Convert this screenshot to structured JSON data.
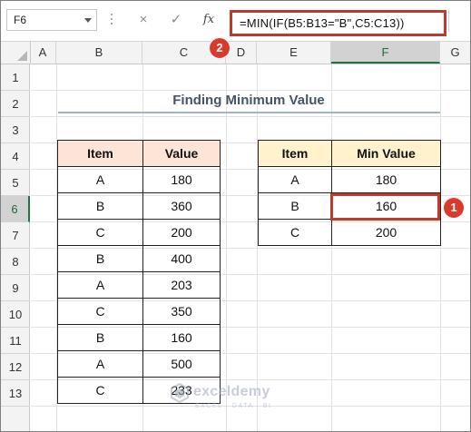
{
  "formula_bar": {
    "name_box": "F6",
    "cancel_icon": "×",
    "enter_icon": "✓",
    "fx_label": "fx",
    "formula": "=MIN(IF(B5:B13=\"B\",C5:C13))"
  },
  "callouts": {
    "one": "1",
    "two": "2"
  },
  "columns": [
    "A",
    "B",
    "C",
    "D",
    "E",
    "F",
    "G"
  ],
  "rows": [
    "1",
    "2",
    "3",
    "4",
    "5",
    "6",
    "7",
    "8",
    "9",
    "10",
    "11",
    "12",
    "13"
  ],
  "selected_cell": "F6",
  "sheet_title": "Finding Minimum Value",
  "data_table": {
    "headers": [
      "Item",
      "Value"
    ],
    "rows": [
      [
        "A",
        "180"
      ],
      [
        "B",
        "360"
      ],
      [
        "C",
        "200"
      ],
      [
        "B",
        "400"
      ],
      [
        "A",
        "203"
      ],
      [
        "C",
        "350"
      ],
      [
        "B",
        "160"
      ],
      [
        "A",
        "500"
      ],
      [
        "C",
        "233"
      ]
    ]
  },
  "result_table": {
    "headers": [
      "Item",
      "Min Value"
    ],
    "rows": [
      [
        "A",
        "180"
      ],
      [
        "B",
        "160"
      ],
      [
        "C",
        "200"
      ]
    ]
  },
  "watermark": {
    "name": "exceldemy",
    "tagline": "EXCEL · DATA · BI"
  },
  "colors": {
    "highlight_red": "#c0392b",
    "header_peach": "#fce4d6",
    "header_yellow": "#fff2cc",
    "excel_green": "#217346"
  }
}
